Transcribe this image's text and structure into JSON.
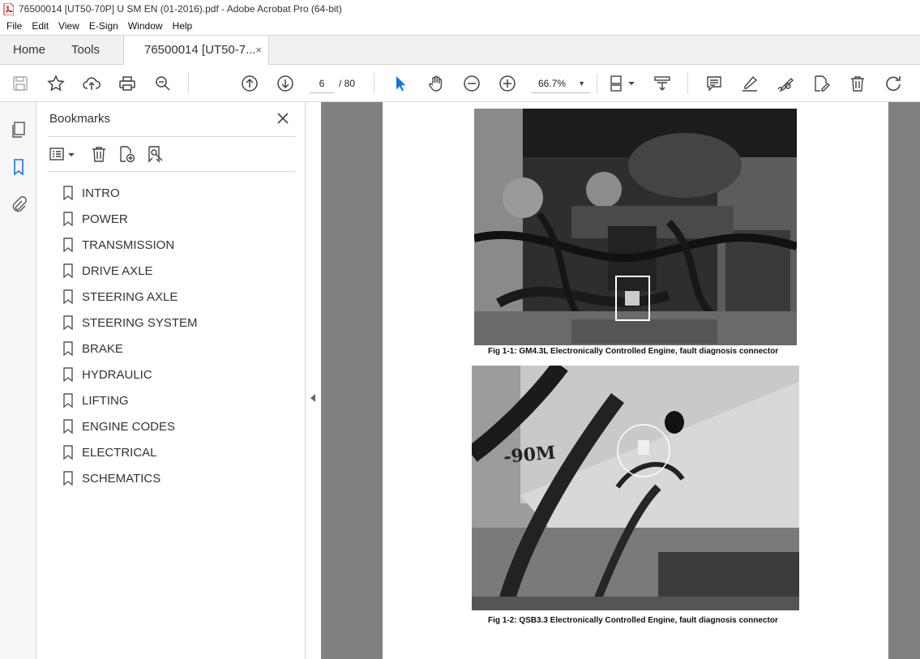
{
  "window": {
    "title": "76500014 [UT50-70P] U SM EN (01-2016).pdf - Adobe Acrobat Pro (64-bit)"
  },
  "menu": [
    "File",
    "Edit",
    "View",
    "E-Sign",
    "Window",
    "Help"
  ],
  "tabs": {
    "home": "Home",
    "tools": "Tools",
    "document": "76500014 [UT50-7...",
    "close_glyph": "×"
  },
  "toolbar": {
    "page_current": "6",
    "page_total": "/ 80",
    "zoom": "66.7%",
    "zoom_caret": "▼",
    "icons": [
      "save-icon",
      "star-icon",
      "upload-icon",
      "print-icon",
      "zoom-search-icon",
      "page-up-icon",
      "page-down-icon",
      "select-arrow-icon",
      "hand-icon",
      "zoom-out-icon",
      "zoom-in-icon",
      "page-layout-icon",
      "scroll-mode-icon",
      "comment-icon",
      "highlight-icon",
      "sign-icon",
      "edit-pdf-icon",
      "trash-icon",
      "redo-icon"
    ],
    "accent_color": "#1473e6"
  },
  "bookmarks": {
    "title": "Bookmarks",
    "close_glyph": "✕",
    "items": [
      "INTRO",
      "POWER",
      "TRANSMISSION",
      "DRIVE AXLE",
      "STEERING AXLE",
      "STEERING SYSTEM",
      "BRAKE",
      "HYDRAULIC",
      "LIFTING",
      "ENGINE CODES",
      "ELECTRICAL",
      "SCHEMATICS"
    ]
  },
  "document": {
    "caption1": "Fig 1-1: GM4.3L Electronically Controlled Engine, fault diagnosis connector",
    "caption2": "Fig 1-2: QSB3.3 Electronically Controlled Engine, fault diagnosis connector"
  }
}
